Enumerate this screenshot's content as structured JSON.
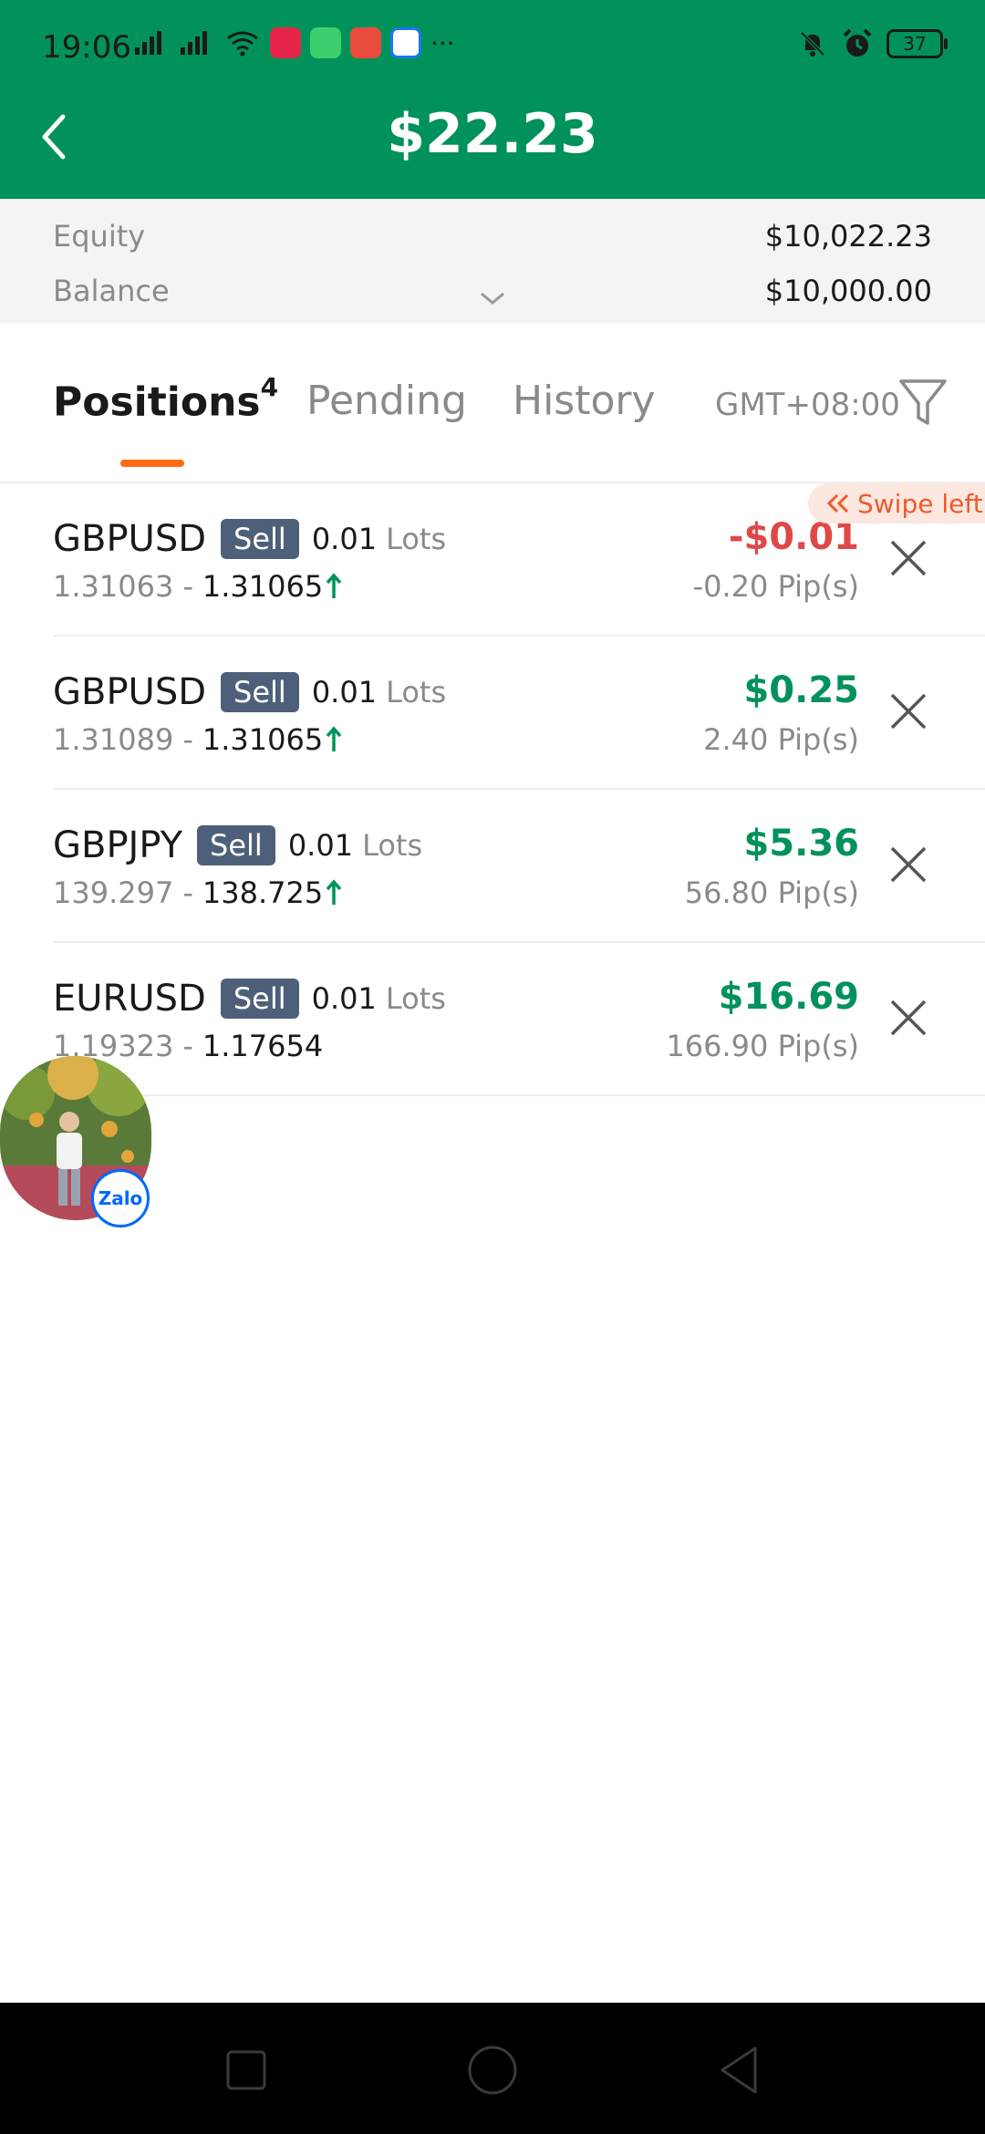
{
  "status_bar": {
    "time": "19:06",
    "battery": "37",
    "overflow": "···"
  },
  "header": {
    "title": "$22.23",
    "back_icon": "chevron-left-icon"
  },
  "summary": {
    "equity_label": "Equity",
    "equity_value": "$10,022.23",
    "balance_label": "Balance",
    "balance_value": "$10,000.00"
  },
  "tabs": {
    "positions_label": "Positions",
    "positions_count": "4",
    "pending_label": "Pending",
    "history_label": "History",
    "timezone": "GMT+08:00"
  },
  "swipe_hint": "Swipe left",
  "positions": [
    {
      "symbol": "GBPUSD",
      "side": "Sell",
      "lots": "0.01",
      "lots_unit": "Lots",
      "open_price": "1.31063",
      "separator": "-",
      "current_price": "1.31065",
      "trend": "up",
      "pl": "-$0.01",
      "pl_sign": "negative",
      "pips": "-0.20 Pip(s)"
    },
    {
      "symbol": "GBPUSD",
      "side": "Sell",
      "lots": "0.01",
      "lots_unit": "Lots",
      "open_price": "1.31089",
      "separator": "-",
      "current_price": "1.31065",
      "trend": "up",
      "pl": "$0.25",
      "pl_sign": "positive",
      "pips": "2.40 Pip(s)"
    },
    {
      "symbol": "GBPJPY",
      "side": "Sell",
      "lots": "0.01",
      "lots_unit": "Lots",
      "open_price": "139.297",
      "separator": "-",
      "current_price": "138.725",
      "trend": "up",
      "pl": "$5.36",
      "pl_sign": "positive",
      "pips": "56.80 Pip(s)"
    },
    {
      "symbol": "EURUSD",
      "side": "Sell",
      "lots": "0.01",
      "lots_unit": "Lots",
      "open_price": "1.19323",
      "separator": "-",
      "current_price": "1.17654",
      "trend": "none",
      "pl": "$16.69",
      "pl_sign": "positive",
      "pips": "166.90 Pip(s)"
    }
  ],
  "chat_bubble": {
    "badge": "Zalo"
  },
  "colors": {
    "brand_green": "#00925a",
    "loss_red": "#e04848",
    "tab_accent": "#ff6a13",
    "sell_badge": "#4e6079"
  }
}
